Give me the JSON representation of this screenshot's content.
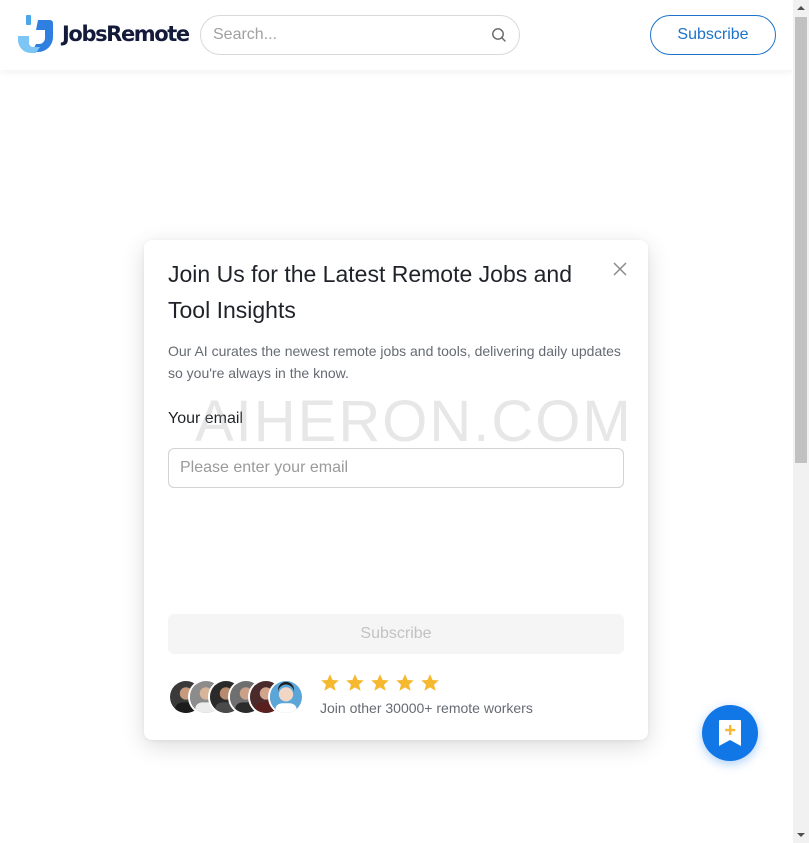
{
  "header": {
    "logo_text": "JobsRemote",
    "search_placeholder": "Search...",
    "search_icon": "search-icon",
    "subscribe_label": "Subscribe"
  },
  "modal": {
    "title": "Join Us for the Latest Remote Jobs and Tool Insights",
    "description": "Our AI curates the newest remote jobs and tools, delivering daily updates so you're always in the know.",
    "email_label": "Your email",
    "email_placeholder": "Please enter your email",
    "email_value": "",
    "subscribe_label": "Subscribe",
    "close_icon": "close-icon",
    "rating_stars": 5,
    "social_proof": "Join other 30000+ remote workers",
    "avatar_count": 6
  },
  "fab": {
    "icon": "bookmark-plus-icon"
  },
  "watermark": "AIHERON.COM",
  "colors": {
    "brand_blue": "#1d73c9",
    "fab_blue": "#1177e6",
    "star_yellow": "#f5b82e",
    "logo_navy": "#131a3a"
  }
}
